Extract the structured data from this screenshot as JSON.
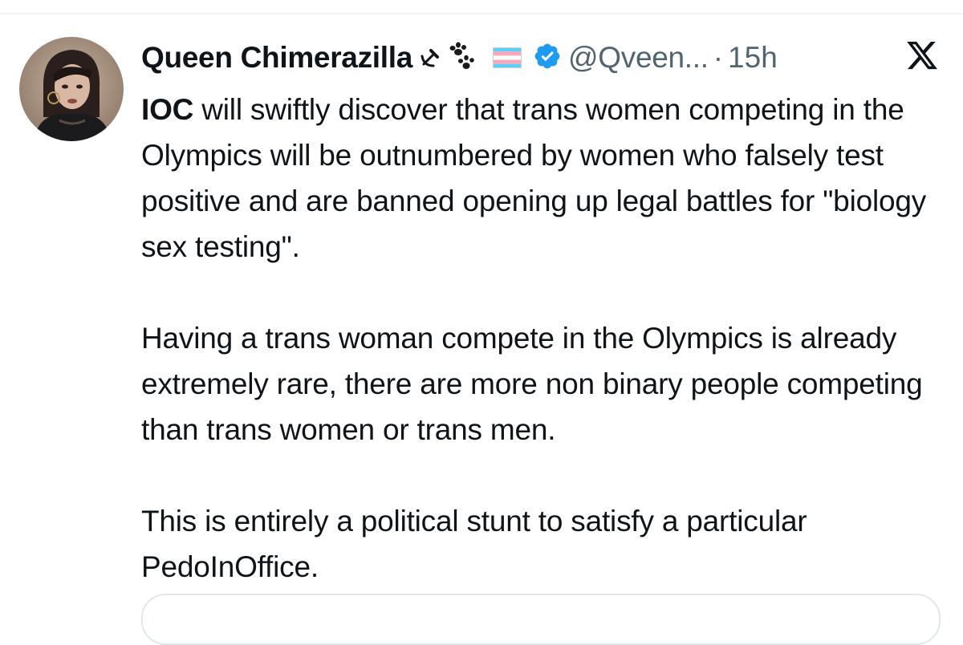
{
  "tweet": {
    "author": {
      "display_name": "Queen Chimerazilla",
      "handle": "@Qveen...",
      "emojis": [
        "hammer-sickle",
        "paw-prints",
        "transgender-flag"
      ],
      "verified": true
    },
    "separator": "·",
    "timestamp": "15h",
    "body": {
      "lead": "IOC",
      "para1_rest": " will swiftly discover that trans women competing in the Olympics will be outnumbered by women who falsely test positive and are banned opening up legal battles for \"biology sex testing\".",
      "para2": "Having a trans woman compete in the Olympics is already extremely rare, there are more non binary people competing than trans women or trans men.",
      "para3": "This is entirely a political stunt to satisfy a particular PedoInOffice."
    }
  },
  "colors": {
    "text": "#0f1419",
    "muted": "#536471",
    "verified": "#1d9bf0",
    "divider": "#eff3f4",
    "trans_blue": "#5bcefa",
    "trans_pink": "#f5a9b8"
  },
  "icons": {
    "logo": "x-logo-icon",
    "verified": "verified-badge-icon"
  }
}
